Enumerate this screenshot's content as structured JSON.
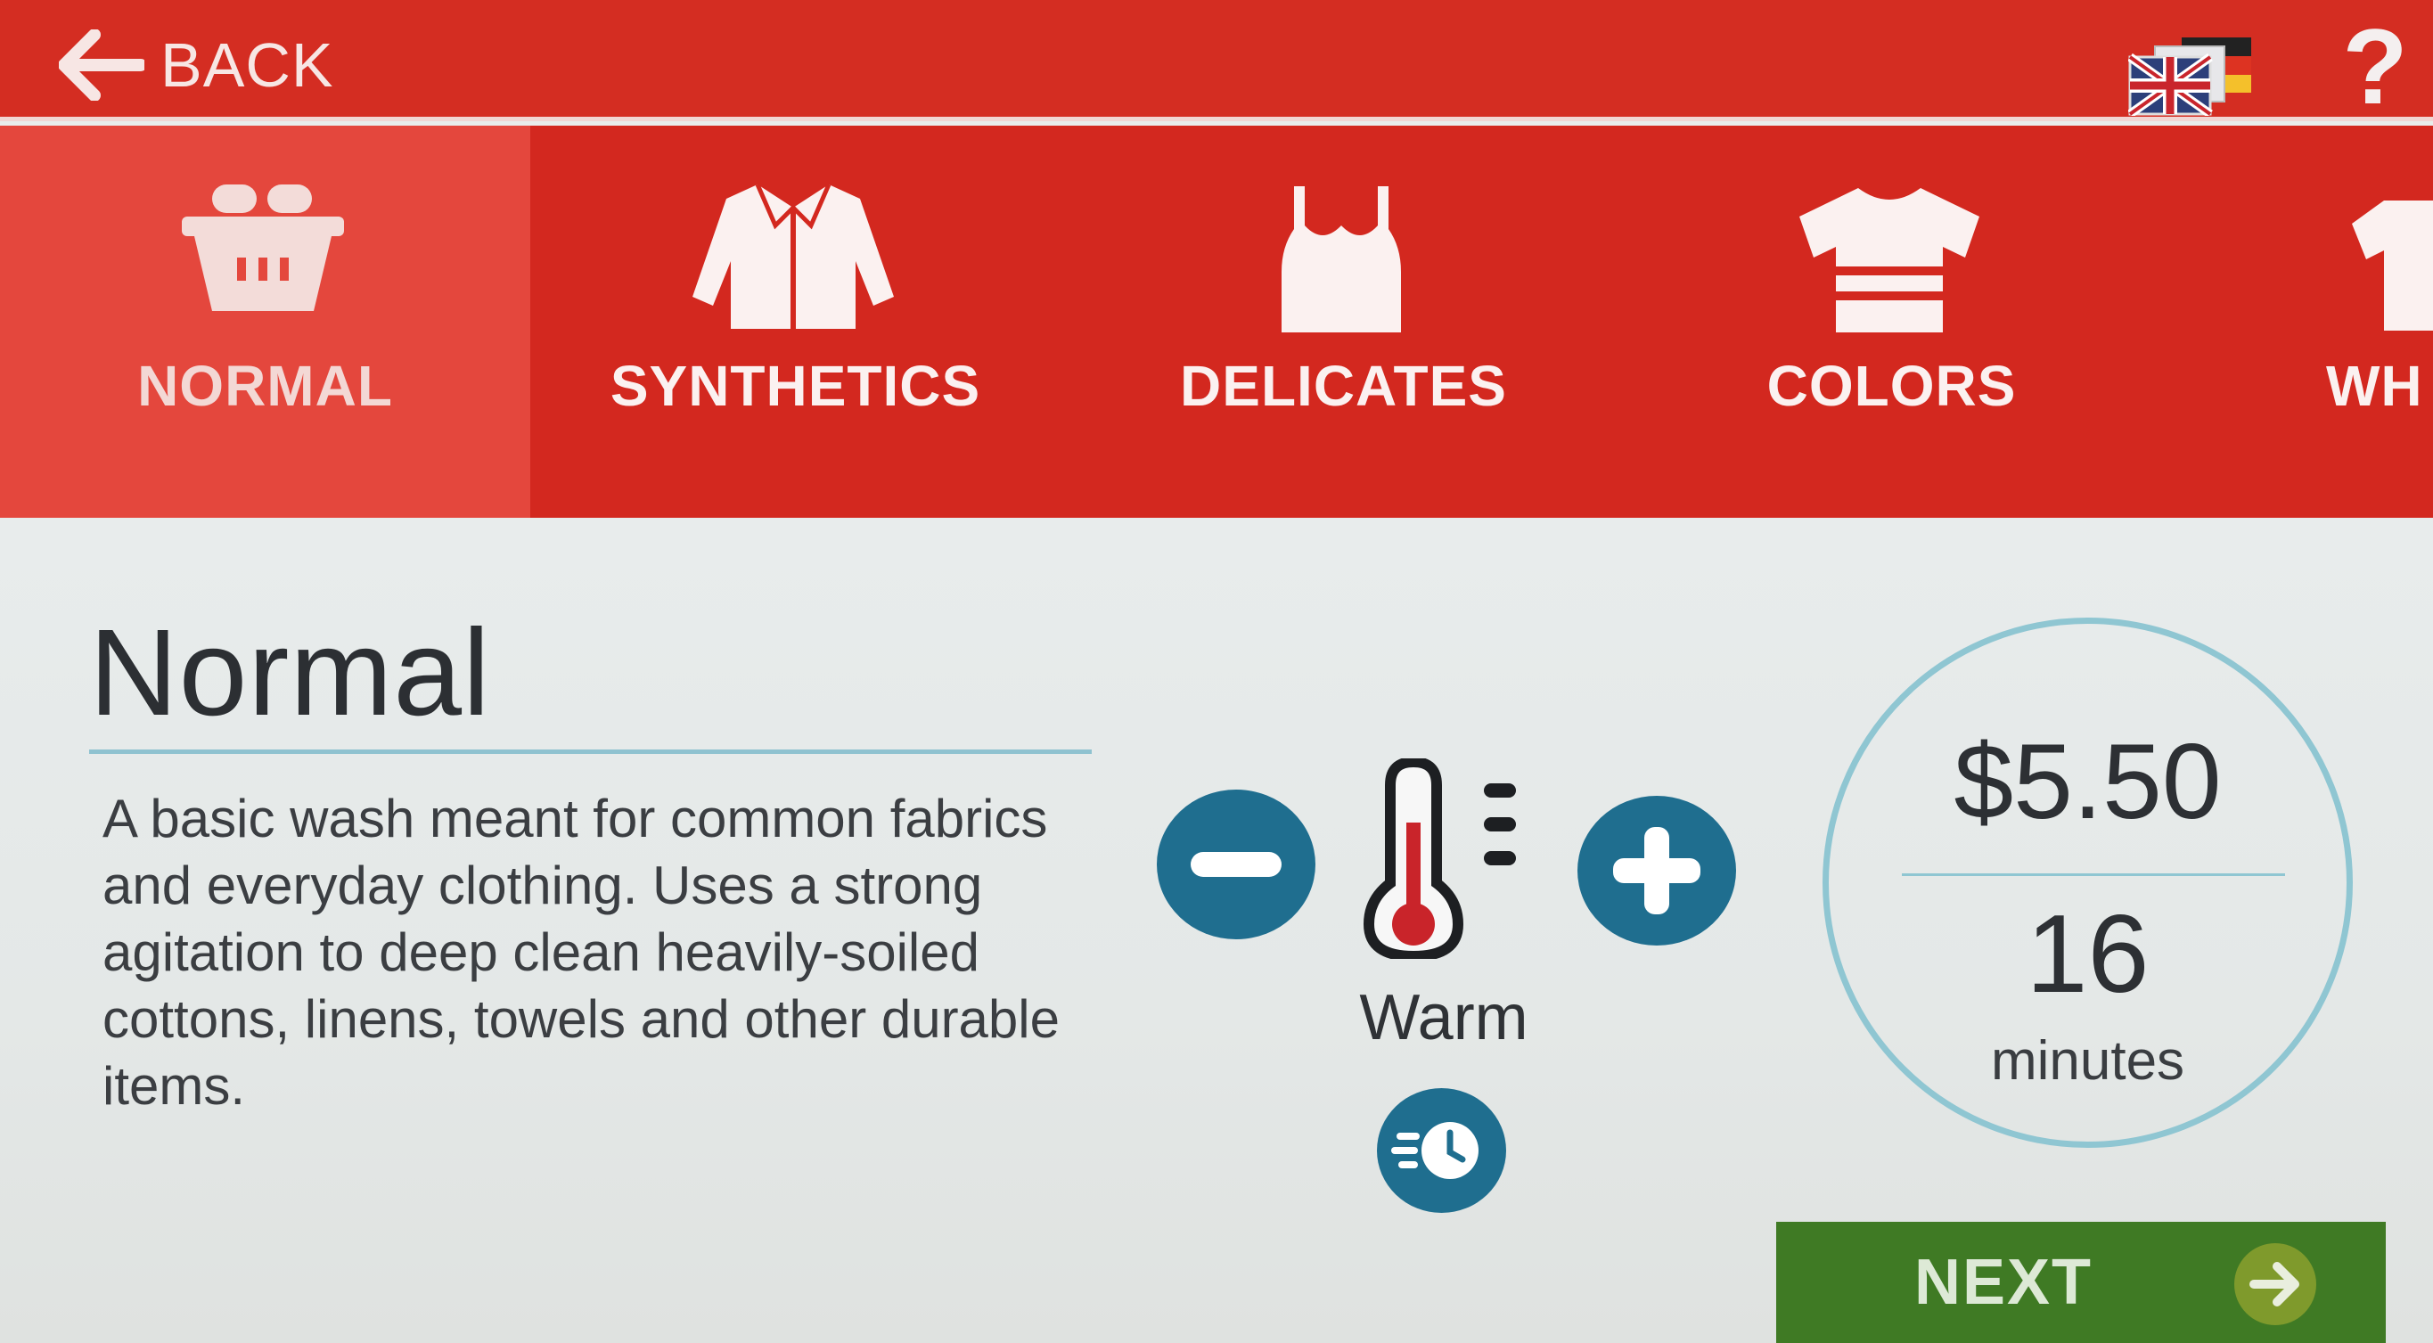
{
  "header": {
    "back_label": "BACK",
    "language_icon": "language-flags-icon",
    "help_label": "?"
  },
  "programs": [
    {
      "label": "NORMAL",
      "icon": "basket-icon",
      "active": true
    },
    {
      "label": "SYNTHETICS",
      "icon": "jacket-icon",
      "active": false
    },
    {
      "label": "DELICATES",
      "icon": "camisole-icon",
      "active": false
    },
    {
      "label": "COLORS",
      "icon": "tshirt-icon",
      "active": false
    },
    {
      "label": "WH",
      "icon": "shirt-icon",
      "active": false
    }
  ],
  "details": {
    "title": "Normal",
    "description": "A basic wash meant for common fabrics and everyday clothing. Uses a strong agitation to deep clean heavily-soiled cottons, linens, towels and other durable items."
  },
  "temperature": {
    "label": "Warm",
    "decrease_icon": "minus-icon",
    "increase_icon": "plus-icon",
    "icon": "thermometer-icon",
    "quick_icon": "quick-timer-icon"
  },
  "summary": {
    "price": "$5.50",
    "duration": "16",
    "duration_unit": "minutes"
  },
  "footer": {
    "next_label": "NEXT",
    "next_icon": "arrow-right-icon"
  },
  "colors": {
    "header_red": "#d42d22",
    "active_tab": "#e4473d",
    "accent_blue": "#1f6e8f",
    "next_green": "#3f7a24"
  }
}
